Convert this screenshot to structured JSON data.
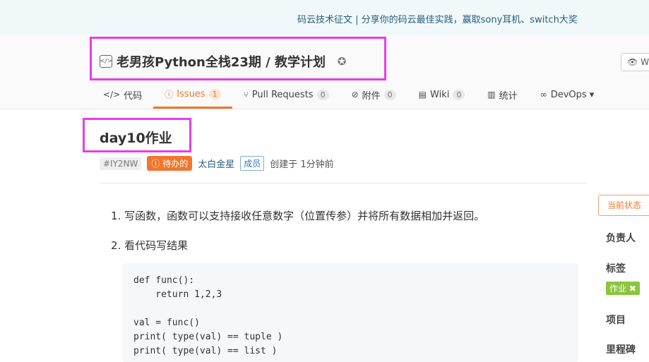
{
  "banner": {
    "text": "码云技术征文 | 分享你的码云最佳实践，赢取sony耳机、switch大奖"
  },
  "repo": {
    "code_icon_glyph": "</>",
    "title": "老男孩Python全栈23期 / 教学计划",
    "watch_label": "W"
  },
  "tabs": [
    {
      "icon": "</>",
      "label": "代码",
      "count": null
    },
    {
      "icon": "ⓘ",
      "label": "Issues",
      "count": "1"
    },
    {
      "icon": "⑂",
      "label": "Pull Requests",
      "count": "0"
    },
    {
      "icon": "⊘",
      "label": "附件",
      "count": "0"
    },
    {
      "icon": "▤",
      "label": "Wiki",
      "count": "0"
    },
    {
      "icon": "▥",
      "label": "统计",
      "count": null
    },
    {
      "icon": "∞",
      "label": "DevOps ▾",
      "count": null
    }
  ],
  "issue": {
    "title": "day10作业",
    "id": "#IY2NW",
    "status": "ⓘ 待办的",
    "author": "太白金星",
    "role": "成员",
    "created": "创建于 1分钟前"
  },
  "content": {
    "item1": "1. 写函数，函数可以支持接收任意数字（位置传参）并将所有数据相加并返回。",
    "item2": "2. 看代码写结果",
    "code": [
      "def func():",
      "    return 1,2,3",
      "",
      "val = func()",
      "print( type(val) == tuple )",
      "print( type(val) == list )"
    ]
  },
  "sidebar": {
    "state_label": "当前状态",
    "assignee_label": "负责人",
    "labels_label": "标签",
    "tag": "作业 ✖",
    "project_label": "项目",
    "milestone_label": "里程碑"
  },
  "colors": {
    "accent": "#f0772c",
    "highlight": "#e83de8",
    "tag": "#8bc53f"
  }
}
